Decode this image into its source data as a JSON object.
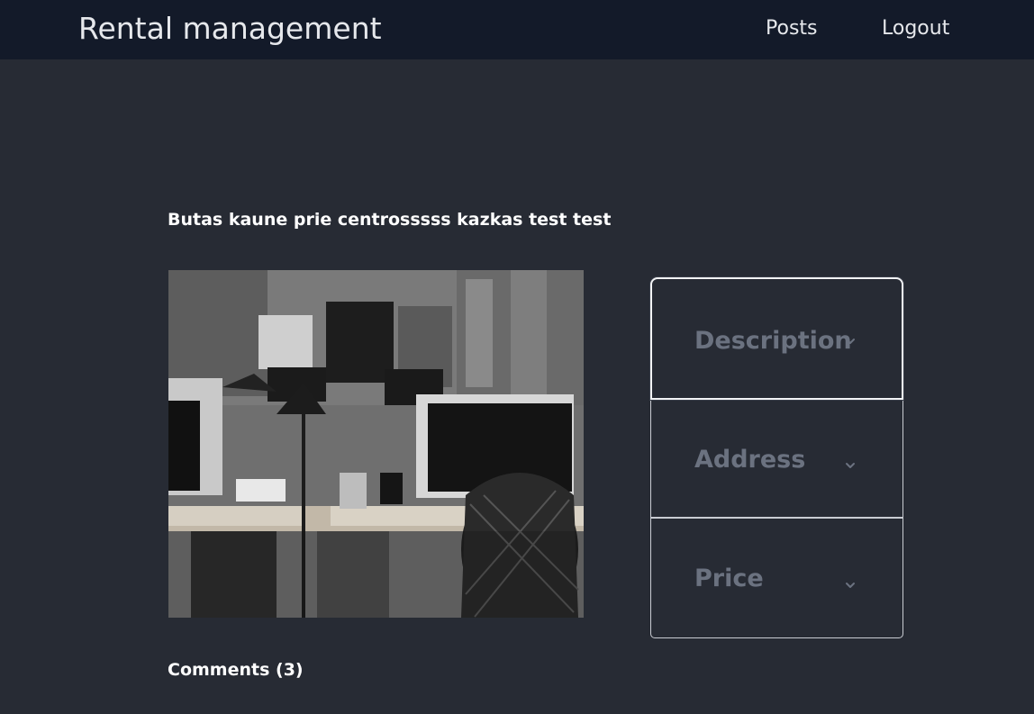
{
  "navbar": {
    "brand": "Rental management",
    "links": [
      {
        "label": "Posts"
      },
      {
        "label": "Logout"
      }
    ]
  },
  "post": {
    "title": "Butas kaune prie centrosssss kazkas test test",
    "image_icon": "office-photo"
  },
  "details": {
    "sections": [
      {
        "label": "Description",
        "icon": "chevron-down-icon"
      },
      {
        "label": "Address",
        "icon": "chevron-down-icon"
      },
      {
        "label": "Price",
        "icon": "chevron-down-icon"
      }
    ]
  },
  "comments": {
    "title": "Comments (3)"
  },
  "colors": {
    "navbar_bg": "#131a29",
    "page_bg": "#272b34",
    "muted_label": "#6b7280"
  }
}
